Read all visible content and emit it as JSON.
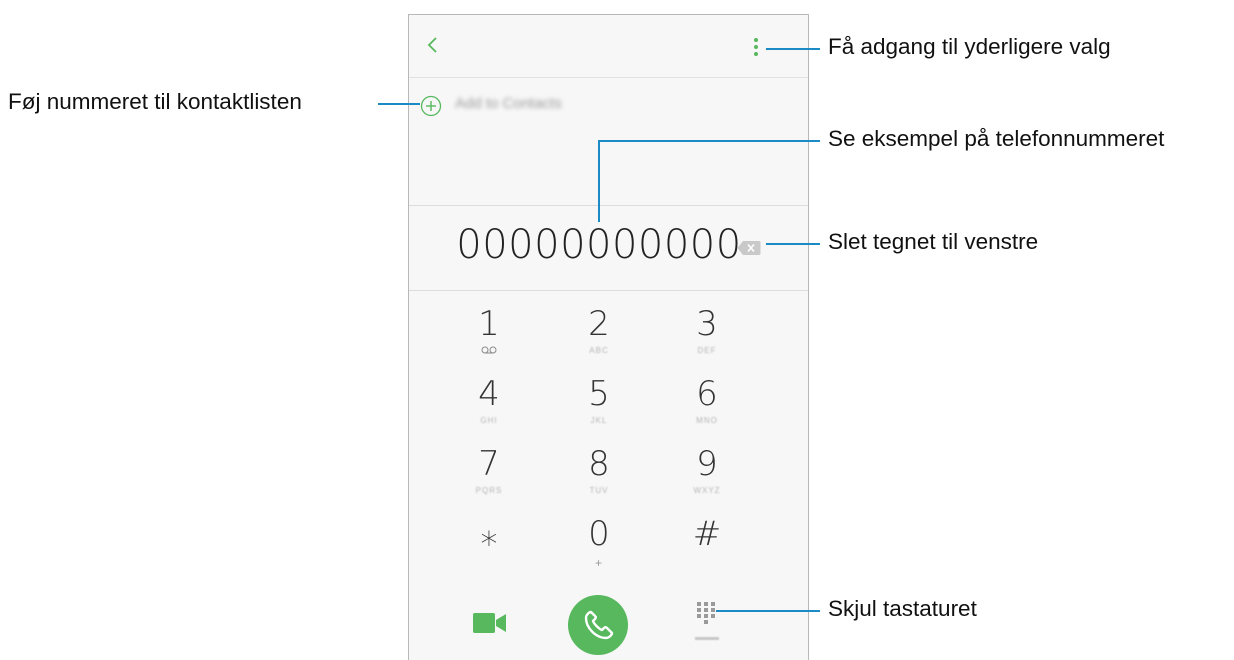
{
  "screen": {
    "add_to_contacts_label": "Add to Contacts",
    "dialed_number": "00000000000"
  },
  "keypad": [
    {
      "digit": "1",
      "letters": "",
      "row": 0,
      "col": 0
    },
    {
      "digit": "2",
      "letters": "ABC",
      "row": 0,
      "col": 1
    },
    {
      "digit": "3",
      "letters": "DEF",
      "row": 0,
      "col": 2
    },
    {
      "digit": "4",
      "letters": "GHI",
      "row": 1,
      "col": 0
    },
    {
      "digit": "5",
      "letters": "JKL",
      "row": 1,
      "col": 1
    },
    {
      "digit": "6",
      "letters": "MNO",
      "row": 1,
      "col": 2
    },
    {
      "digit": "7",
      "letters": "PQRS",
      "row": 2,
      "col": 0
    },
    {
      "digit": "8",
      "letters": "TUV",
      "row": 2,
      "col": 1
    },
    {
      "digit": "9",
      "letters": "WXYZ",
      "row": 2,
      "col": 2
    },
    {
      "digit": "⁎",
      "letters": "",
      "row": 3,
      "col": 0
    },
    {
      "digit": "0",
      "letters": "+",
      "row": 3,
      "col": 1
    },
    {
      "digit": "#",
      "letters": "",
      "row": 3,
      "col": 2
    }
  ],
  "colors": {
    "accent_green": "#57b85d",
    "callout_line": "#1a8bc4"
  },
  "icons": {
    "back": "chevron-left-icon",
    "more": "more-vertical-icon",
    "add": "plus-circle-icon",
    "backspace": "backspace-icon",
    "video_call": "video-camera-icon",
    "call": "phone-icon",
    "hide_keypad": "keypad-icon",
    "voicemail": "voicemail-icon"
  },
  "callouts": {
    "more_options": "Få adgang til yderligere valg",
    "add_to_contacts": "Føj nummeret til kontaktlisten",
    "preview_number": "Se eksempel på telefonnummeret",
    "delete_char": "Slet tegnet til venstre",
    "hide_keypad": "Skjul tastaturet"
  }
}
